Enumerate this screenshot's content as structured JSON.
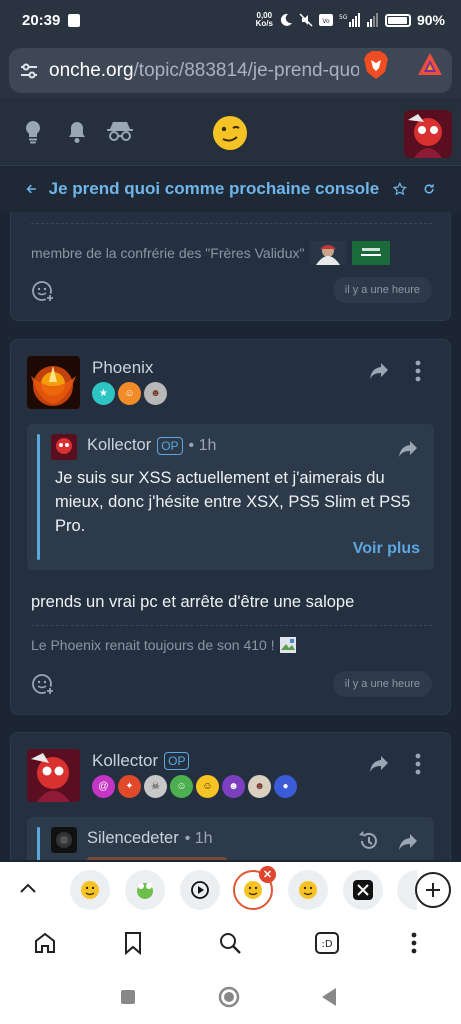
{
  "status": {
    "time": "20:39",
    "speed_top": "0,00",
    "speed_unit": "Ko/s",
    "battery": "90%"
  },
  "browser": {
    "url_host": "onche.org",
    "url_path": "/topic/883814/je-prend-quo"
  },
  "topic": {
    "title": "Je prend quoi comme prochaine console"
  },
  "post1": {
    "signature": "membre de la confrérie des \"Frères Validux\"",
    "time": "il y a une heure"
  },
  "post2": {
    "author": "Phoenix",
    "quote": {
      "author": "Kollector",
      "op": "OP",
      "time": "• 1h",
      "text": "Je suis sur XSS actuellement et j'aimerais du mieux, donc j'hésite entre XSX, PS5 Slim et PS5 Pro.",
      "more": "Voir plus"
    },
    "body": "prends un vrai pc et arrête d'être une salope",
    "signature": "Le Phoenix renait toujours de son 410 !",
    "time": "il y a une heure"
  },
  "post3": {
    "author": "Kollector",
    "op": "OP",
    "quote": {
      "author": "Silencedeter",
      "time": "• 1h"
    }
  },
  "colors": {
    "accent": "#5da7e0",
    "bg": "#1b2533",
    "card": "#243040",
    "tab_active": "#e05634"
  }
}
